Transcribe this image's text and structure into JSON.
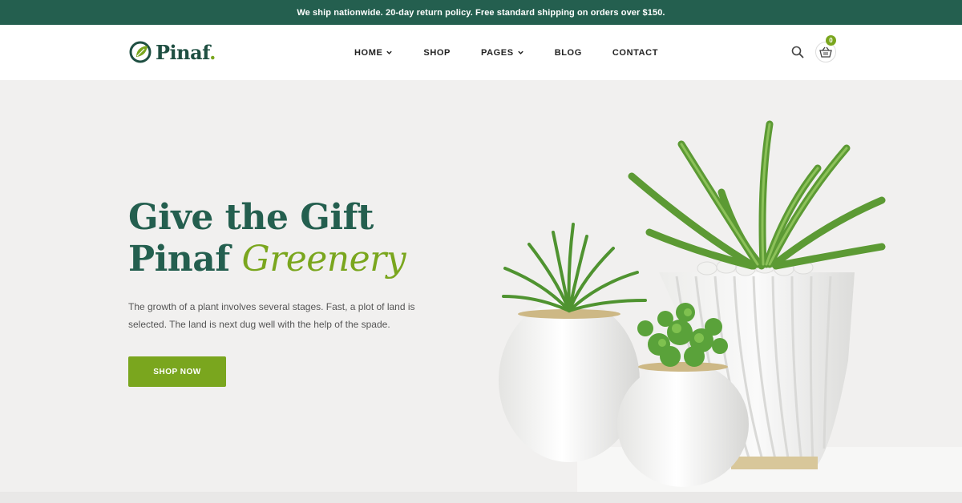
{
  "topbar": {
    "text": "We ship nationwide. 20-day return policy. Free standard shipping on orders over $150."
  },
  "brand": {
    "name": "Pinaf",
    "dot": "."
  },
  "nav": [
    {
      "label": "HOME",
      "dropdown": true
    },
    {
      "label": "SHOP",
      "dropdown": false
    },
    {
      "label": "PAGES",
      "dropdown": true
    },
    {
      "label": "BLOG",
      "dropdown": false
    },
    {
      "label": "CONTACT",
      "dropdown": false
    }
  ],
  "cart": {
    "count": "0"
  },
  "hero": {
    "title_line1": "Give the Gift",
    "title_line2_plain": "Pinaf ",
    "title_line2_accent": "Greenery",
    "description": "The growth of a plant involves several stages. Fast, a plot of land is selected. The land is next dug well with the help of the spade.",
    "cta": "SHOP NOW"
  },
  "colors": {
    "primary": "#245f4f",
    "accent": "#7aa61e",
    "background": "#f1f0ef"
  },
  "icons": [
    "leaf-logo-icon",
    "chevron-down-icon",
    "search-icon",
    "basket-icon"
  ]
}
